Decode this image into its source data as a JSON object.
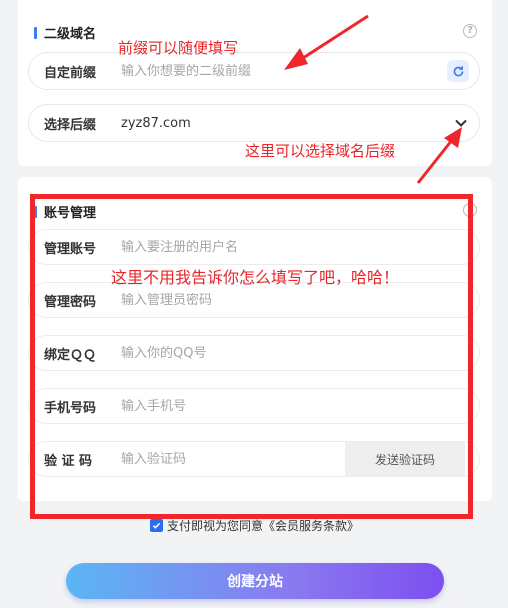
{
  "domain_section": {
    "title": "二级域名",
    "prefix": {
      "label": "自定前缀",
      "placeholder": "输入你想要的二级前缀"
    },
    "suffix": {
      "label": "选择后缀",
      "value": "zyz87.com"
    }
  },
  "account_section": {
    "title": "账号管理",
    "fields": [
      {
        "label": "管理账号",
        "placeholder": "输入要注册的用户名"
      },
      {
        "label": "管理密码",
        "placeholder": "输入管理员密码"
      },
      {
        "label": "绑定ＱＱ",
        "placeholder": "输入你的QQ号"
      },
      {
        "label": "手机号码",
        "placeholder": "输入手机号"
      },
      {
        "label": "验 证 码",
        "placeholder": "输入验证码"
      }
    ],
    "send_code_label": "发送验证码"
  },
  "agreement": {
    "checked": true,
    "text": "支付即视为您同意《会员服务条款》"
  },
  "submit_label": "创建分站",
  "annotations": {
    "prefix_note": "前缀可以随便填写",
    "suffix_note": "这里可以选择域名后缀",
    "account_note": "这里不用我告诉你怎么填写了吧，哈哈！"
  },
  "colors": {
    "accent": "#3a7bf6",
    "annotation_red": "#f0262b",
    "button_gradient_start": "#5bb6f4",
    "button_gradient_end": "#7d4ff0"
  },
  "icons": {
    "help": "question-circle-icon",
    "refresh": "refresh-icon",
    "dropdown": "chevron-down-icon",
    "checkbox": "checkmark-icon"
  }
}
